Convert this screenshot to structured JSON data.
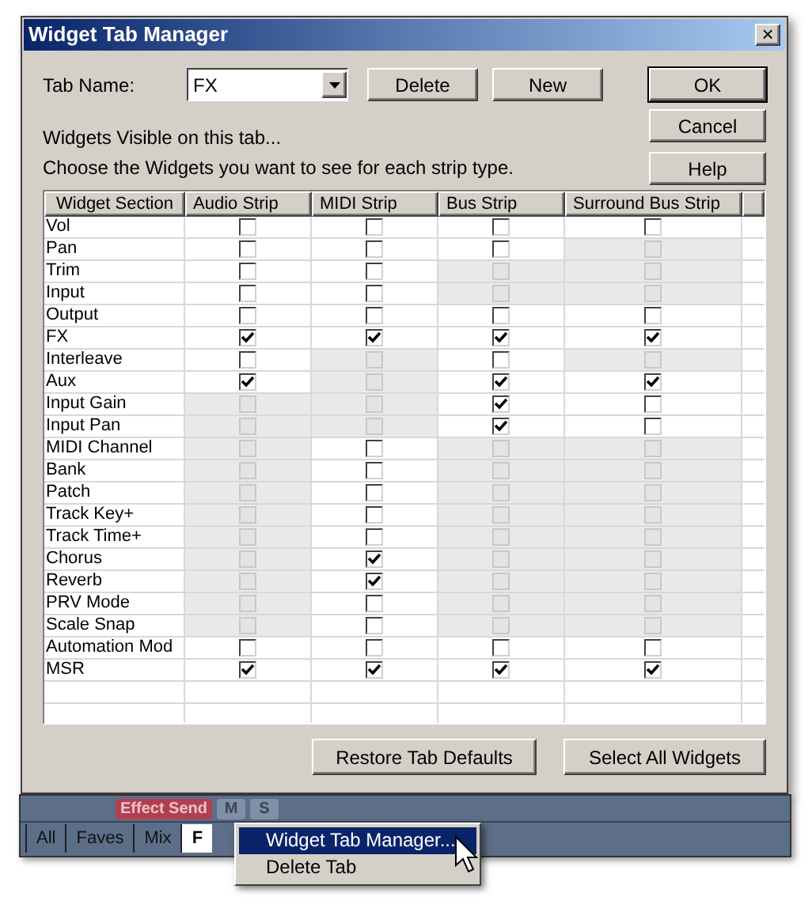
{
  "window": {
    "title": "Widget Tab Manager",
    "close": "×"
  },
  "tab_name": {
    "label": "Tab Name:",
    "value": "FX"
  },
  "buttons": [
    {
      "label": "Delete",
      "kind": "plain"
    },
    {
      "label": "New",
      "kind": "plain"
    }
  ],
  "side_buttons": [
    {
      "label": "OK",
      "default": true
    },
    {
      "label": "Cancel",
      "default": false
    },
    {
      "label": "Help",
      "default": false
    }
  ],
  "intro": [
    "Widgets Visible on this tab...",
    "Choose the Widgets you want to see for each strip type."
  ],
  "table": {
    "columns": [
      "Widget Section",
      "Audio Strip",
      "MIDI Strip",
      "Bus Strip",
      "Surround Bus Strip"
    ],
    "rows": [
      {
        "name": "Vol",
        "cells": [
          {
            "checked": false,
            "disabled": false
          },
          {
            "checked": false,
            "disabled": false
          },
          {
            "checked": false,
            "disabled": false
          },
          {
            "checked": false,
            "disabled": false
          }
        ]
      },
      {
        "name": "Pan",
        "cells": [
          {
            "checked": false,
            "disabled": false
          },
          {
            "checked": false,
            "disabled": false
          },
          {
            "checked": false,
            "disabled": false
          },
          {
            "checked": false,
            "disabled": true
          }
        ]
      },
      {
        "name": "Trim",
        "cells": [
          {
            "checked": false,
            "disabled": false
          },
          {
            "checked": false,
            "disabled": false
          },
          {
            "checked": false,
            "disabled": true
          },
          {
            "checked": false,
            "disabled": true
          }
        ]
      },
      {
        "name": "Input",
        "cells": [
          {
            "checked": false,
            "disabled": false
          },
          {
            "checked": false,
            "disabled": false
          },
          {
            "checked": false,
            "disabled": true
          },
          {
            "checked": false,
            "disabled": true
          }
        ]
      },
      {
        "name": "Output",
        "cells": [
          {
            "checked": false,
            "disabled": false
          },
          {
            "checked": false,
            "disabled": false
          },
          {
            "checked": false,
            "disabled": false
          },
          {
            "checked": false,
            "disabled": false
          }
        ]
      },
      {
        "name": "FX",
        "cells": [
          {
            "checked": true,
            "disabled": false
          },
          {
            "checked": true,
            "disabled": false
          },
          {
            "checked": true,
            "disabled": false
          },
          {
            "checked": true,
            "disabled": false
          }
        ]
      },
      {
        "name": "Interleave",
        "cells": [
          {
            "checked": false,
            "disabled": false
          },
          {
            "checked": false,
            "disabled": true
          },
          {
            "checked": false,
            "disabled": false
          },
          {
            "checked": false,
            "disabled": true
          }
        ]
      },
      {
        "name": "Aux",
        "cells": [
          {
            "checked": true,
            "disabled": false
          },
          {
            "checked": false,
            "disabled": true
          },
          {
            "checked": true,
            "disabled": false
          },
          {
            "checked": true,
            "disabled": false
          }
        ]
      },
      {
        "name": "Input Gain",
        "cells": [
          {
            "checked": false,
            "disabled": true
          },
          {
            "checked": false,
            "disabled": true
          },
          {
            "checked": true,
            "disabled": false
          },
          {
            "checked": false,
            "disabled": false
          }
        ]
      },
      {
        "name": "Input Pan",
        "cells": [
          {
            "checked": false,
            "disabled": true
          },
          {
            "checked": false,
            "disabled": true
          },
          {
            "checked": true,
            "disabled": false
          },
          {
            "checked": false,
            "disabled": false
          }
        ]
      },
      {
        "name": "MIDI Channel",
        "cells": [
          {
            "checked": false,
            "disabled": true
          },
          {
            "checked": false,
            "disabled": false
          },
          {
            "checked": false,
            "disabled": true
          },
          {
            "checked": false,
            "disabled": true
          }
        ]
      },
      {
        "name": "Bank",
        "cells": [
          {
            "checked": false,
            "disabled": true
          },
          {
            "checked": false,
            "disabled": false
          },
          {
            "checked": false,
            "disabled": true
          },
          {
            "checked": false,
            "disabled": true
          }
        ]
      },
      {
        "name": "Patch",
        "cells": [
          {
            "checked": false,
            "disabled": true
          },
          {
            "checked": false,
            "disabled": false
          },
          {
            "checked": false,
            "disabled": true
          },
          {
            "checked": false,
            "disabled": true
          }
        ]
      },
      {
        "name": "Track Key+",
        "cells": [
          {
            "checked": false,
            "disabled": true
          },
          {
            "checked": false,
            "disabled": false
          },
          {
            "checked": false,
            "disabled": true
          },
          {
            "checked": false,
            "disabled": true
          }
        ]
      },
      {
        "name": "Track Time+",
        "cells": [
          {
            "checked": false,
            "disabled": true
          },
          {
            "checked": false,
            "disabled": false
          },
          {
            "checked": false,
            "disabled": true
          },
          {
            "checked": false,
            "disabled": true
          }
        ]
      },
      {
        "name": "Chorus",
        "cells": [
          {
            "checked": false,
            "disabled": true
          },
          {
            "checked": true,
            "disabled": false
          },
          {
            "checked": false,
            "disabled": true
          },
          {
            "checked": false,
            "disabled": true
          }
        ]
      },
      {
        "name": "Reverb",
        "cells": [
          {
            "checked": false,
            "disabled": true
          },
          {
            "checked": true,
            "disabled": false
          },
          {
            "checked": false,
            "disabled": true
          },
          {
            "checked": false,
            "disabled": true
          }
        ]
      },
      {
        "name": "PRV Mode",
        "cells": [
          {
            "checked": false,
            "disabled": true
          },
          {
            "checked": false,
            "disabled": false
          },
          {
            "checked": false,
            "disabled": true
          },
          {
            "checked": false,
            "disabled": true
          }
        ]
      },
      {
        "name": "Scale Snap",
        "cells": [
          {
            "checked": false,
            "disabled": true
          },
          {
            "checked": false,
            "disabled": false
          },
          {
            "checked": false,
            "disabled": true
          },
          {
            "checked": false,
            "disabled": true
          }
        ]
      },
      {
        "name": "Automation Mod",
        "cells": [
          {
            "checked": false,
            "disabled": false
          },
          {
            "checked": false,
            "disabled": false
          },
          {
            "checked": false,
            "disabled": false
          },
          {
            "checked": false,
            "disabled": false
          }
        ]
      },
      {
        "name": "MSR",
        "cells": [
          {
            "checked": true,
            "disabled": false
          },
          {
            "checked": true,
            "disabled": false
          },
          {
            "checked": true,
            "disabled": false
          },
          {
            "checked": true,
            "disabled": false
          }
        ]
      }
    ]
  },
  "footer_buttons": [
    "Restore Tab Defaults",
    "Select All Widgets"
  ],
  "background_app": {
    "strip_label": "Effect Send",
    "strip_buttons": [
      "M",
      "S"
    ],
    "tabs": [
      {
        "label": "All",
        "selected": false
      },
      {
        "label": "Faves",
        "selected": false
      },
      {
        "label": "Mix",
        "selected": false
      },
      {
        "label": "F",
        "selected": true
      }
    ]
  },
  "context_menu": [
    {
      "label": "Widget Tab Manager...",
      "selected": true
    },
    {
      "label": "Delete Tab",
      "selected": false
    }
  ]
}
